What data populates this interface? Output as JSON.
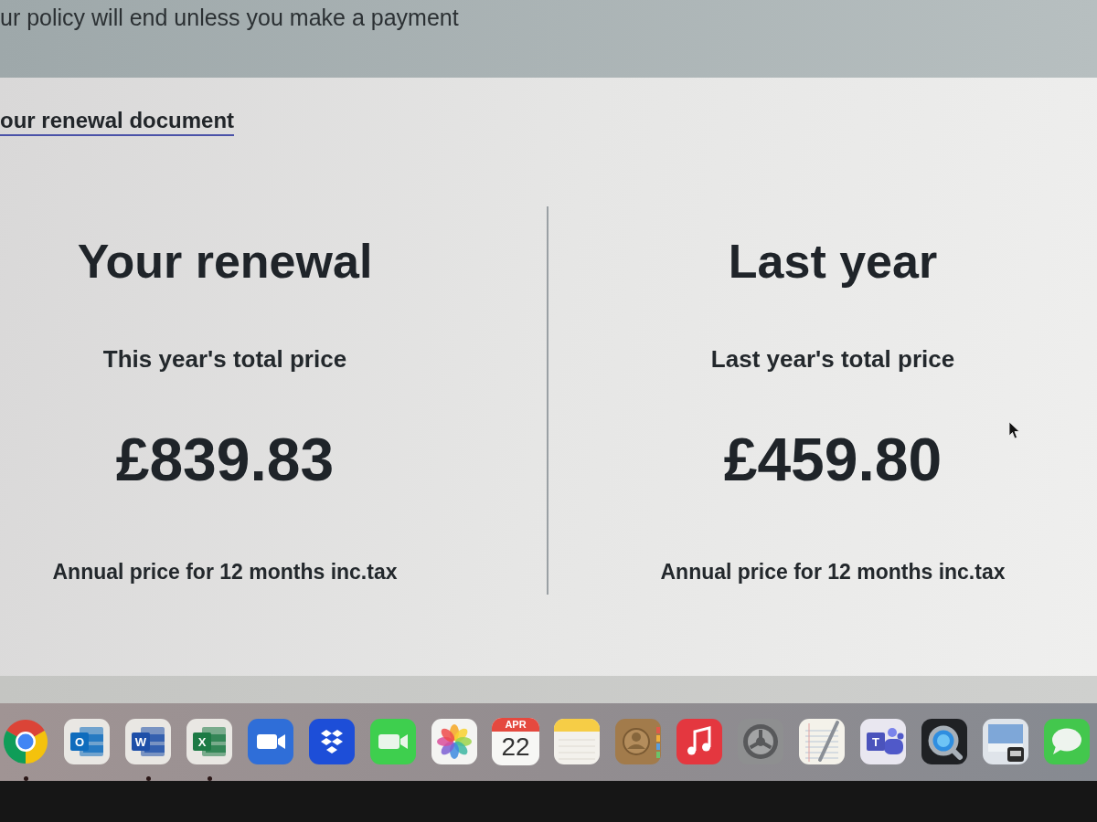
{
  "notice": {
    "text": "ur policy will end unless you make a payment"
  },
  "link": {
    "text": "our renewal document"
  },
  "comparison": [
    {
      "heading": "Your renewal",
      "label": "This year's total price",
      "price": "£839.83",
      "note": "Annual price for 12 months inc.tax"
    },
    {
      "heading": "Last year",
      "label": "Last year's total price",
      "price": "£459.80",
      "note": "Annual price for 12 months inc.tax"
    }
  ],
  "dock": [
    {
      "kind": "browser",
      "running": true
    },
    {
      "kind": "letter_tile",
      "letter": "O",
      "color": "#0f6cbd",
      "running": false
    },
    {
      "kind": "letter_tile",
      "letter": "W",
      "color": "#1e4fa8",
      "running": true
    },
    {
      "kind": "letter_tile",
      "letter": "X",
      "color": "#1d7a45",
      "running": true
    },
    {
      "kind": "video_tile",
      "running": false
    },
    {
      "kind": "diamonds",
      "running": false
    },
    {
      "kind": "facetime",
      "running": false
    },
    {
      "kind": "photos",
      "running": false
    },
    {
      "kind": "calendar",
      "month": "APR",
      "day": "22",
      "running": false
    },
    {
      "kind": "notes",
      "running": false
    },
    {
      "kind": "contacts",
      "running": false
    },
    {
      "kind": "music",
      "running": false
    },
    {
      "kind": "settings",
      "running": false
    },
    {
      "kind": "textedit",
      "running": false
    },
    {
      "kind": "team_tile",
      "letter": "T",
      "color": "#4b53bc",
      "running": false
    },
    {
      "kind": "quicktime",
      "running": false
    },
    {
      "kind": "preview",
      "running": false
    },
    {
      "kind": "messages",
      "running": false
    }
  ]
}
